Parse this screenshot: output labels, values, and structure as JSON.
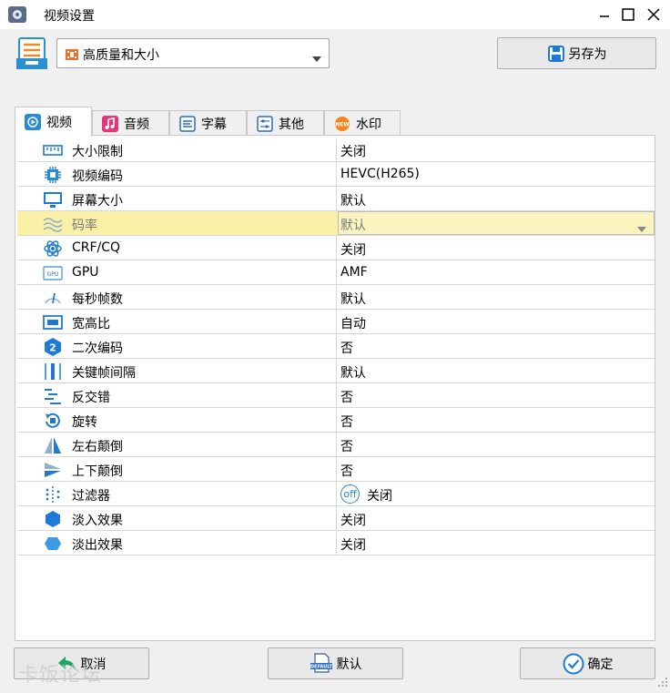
{
  "window": {
    "title": "视频设置",
    "icons": [
      "app-gear-icon",
      "minimize-icon",
      "maximize-icon",
      "close-icon"
    ]
  },
  "preset": {
    "icon": "preset-list-icon",
    "value": "高质量和大小",
    "value_icon": "film-icon"
  },
  "save_as": {
    "label": "另存为",
    "icon": "floppy-disk-icon"
  },
  "tabs": [
    {
      "label": "视频",
      "icon": "play-icon",
      "active": true
    },
    {
      "label": "音频",
      "icon": "music-note-icon"
    },
    {
      "label": "字幕",
      "icon": "subtitle-icon"
    },
    {
      "label": "其他",
      "icon": "sliders-icon"
    },
    {
      "label": "水印",
      "icon": "new-badge-icon"
    }
  ],
  "settings": [
    {
      "name": "大小限制",
      "value": "关闭",
      "icon": "ruler-icon"
    },
    {
      "name": "视频编码",
      "value": "HEVC(H265)",
      "icon": "chip-icon"
    },
    {
      "name": "屏幕大小",
      "value": "默认",
      "icon": "monitor-icon"
    },
    {
      "name": "码率",
      "value": "默认",
      "icon": "wave-icon",
      "highlighted": true
    },
    {
      "name": "CRF/CQ",
      "value": "关闭",
      "icon": "atom-icon"
    },
    {
      "name": "GPU",
      "value": "AMF",
      "icon": "gpu-icon"
    },
    {
      "name": "每秒帧数",
      "value": "默认",
      "icon": "fps-gauge-icon"
    },
    {
      "name": "宽高比",
      "value": "自动",
      "icon": "aspect-ratio-icon"
    },
    {
      "name": "二次编码",
      "value": "否",
      "icon": "two-pass-icon"
    },
    {
      "name": "关键帧间隔",
      "value": "默认",
      "icon": "keyframe-icon"
    },
    {
      "name": "反交错",
      "value": "否",
      "icon": "deinterlace-icon"
    },
    {
      "name": "旋转",
      "value": "否",
      "icon": "rotate-icon"
    },
    {
      "name": "左右颠倒",
      "value": "否",
      "icon": "flip-horizontal-icon"
    },
    {
      "name": "上下颠倒",
      "value": "否",
      "icon": "flip-vertical-icon"
    },
    {
      "name": "过滤器",
      "value": "关闭",
      "icon": "filter-icon",
      "value_badge": "off"
    },
    {
      "name": "淡入效果",
      "value": "关闭",
      "icon": "fade-in-hexagon-icon"
    },
    {
      "name": "淡出效果",
      "value": "关闭",
      "icon": "fade-out-hexagon-icon"
    }
  ],
  "buttons": {
    "cancel": {
      "label": "取消",
      "icon": "back-arrow-icon"
    },
    "default": {
      "label": "默认",
      "icon": "default-doc-icon",
      "icon_text": "DEFAULT"
    },
    "ok": {
      "label": "确定",
      "icon": "check-circle-icon"
    }
  },
  "watermark": "卡饭论坛",
  "colors": {
    "accent": "#1e7ad6",
    "highlight": "#fbf0a8",
    "grid_line": "#d9d9d9"
  }
}
